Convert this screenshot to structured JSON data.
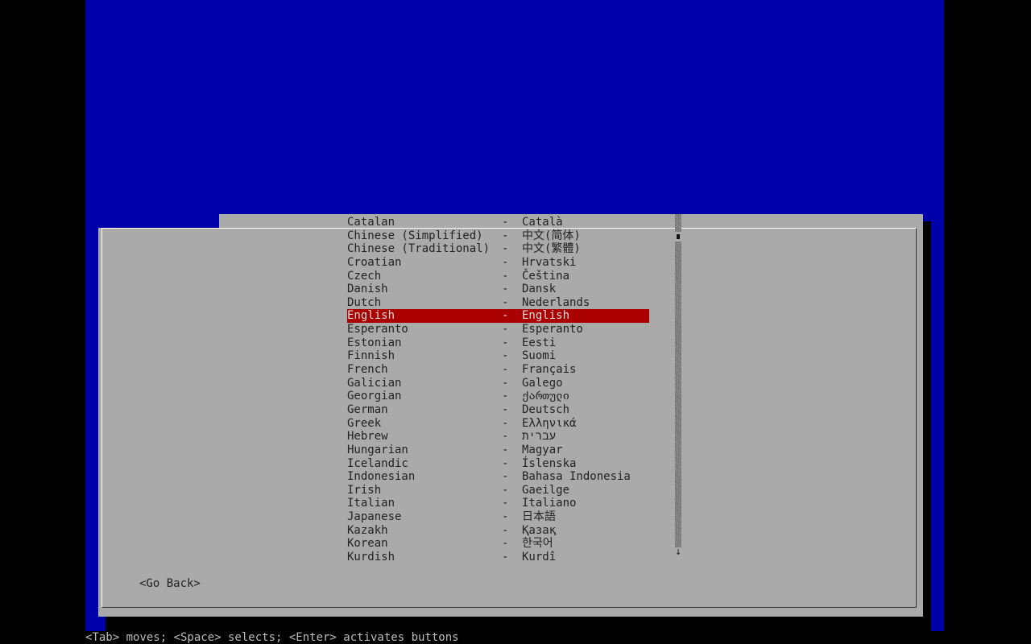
{
  "dialog": {
    "title": "",
    "go_back_label": "<Go Back>"
  },
  "languages": [
    {
      "name": "Catalan",
      "native": "Català"
    },
    {
      "name": "Chinese (Simplified)",
      "native": "中文(简体)"
    },
    {
      "name": "Chinese (Traditional)",
      "native": "中文(繁體)"
    },
    {
      "name": "Croatian",
      "native": "Hrvatski"
    },
    {
      "name": "Czech",
      "native": "Čeština"
    },
    {
      "name": "Danish",
      "native": "Dansk"
    },
    {
      "name": "Dutch",
      "native": "Nederlands"
    },
    {
      "name": "English",
      "native": "English",
      "selected": true
    },
    {
      "name": "Esperanto",
      "native": "Esperanto"
    },
    {
      "name": "Estonian",
      "native": "Eesti"
    },
    {
      "name": "Finnish",
      "native": "Suomi"
    },
    {
      "name": "French",
      "native": "Français"
    },
    {
      "name": "Galician",
      "native": "Galego"
    },
    {
      "name": "Georgian",
      "native": "ქართული"
    },
    {
      "name": "German",
      "native": "Deutsch"
    },
    {
      "name": "Greek",
      "native": "Ελληνικά"
    },
    {
      "name": "Hebrew",
      "native": "עברית"
    },
    {
      "name": "Hungarian",
      "native": "Magyar"
    },
    {
      "name": "Icelandic",
      "native": "Íslenska"
    },
    {
      "name": "Indonesian",
      "native": "Bahasa Indonesia"
    },
    {
      "name": "Irish",
      "native": "Gaeilge"
    },
    {
      "name": "Italian",
      "native": "Italiano"
    },
    {
      "name": "Japanese",
      "native": "日本語"
    },
    {
      "name": "Kazakh",
      "native": "Қазақ"
    },
    {
      "name": "Korean",
      "native": "한국어"
    },
    {
      "name": "Kurdish",
      "native": "Kurdî"
    }
  ],
  "separator": "-",
  "scrollbar": {
    "down_arrow": "↓",
    "position_fraction": 0.05
  },
  "status_bar": {
    "text": "<Tab> moves; <Space> selects; <Enter> activates buttons"
  },
  "colors": {
    "backdrop": "#0000aa",
    "dialog": "#aaaaaa",
    "selection": "#aa0000",
    "shadow": "#000000"
  }
}
